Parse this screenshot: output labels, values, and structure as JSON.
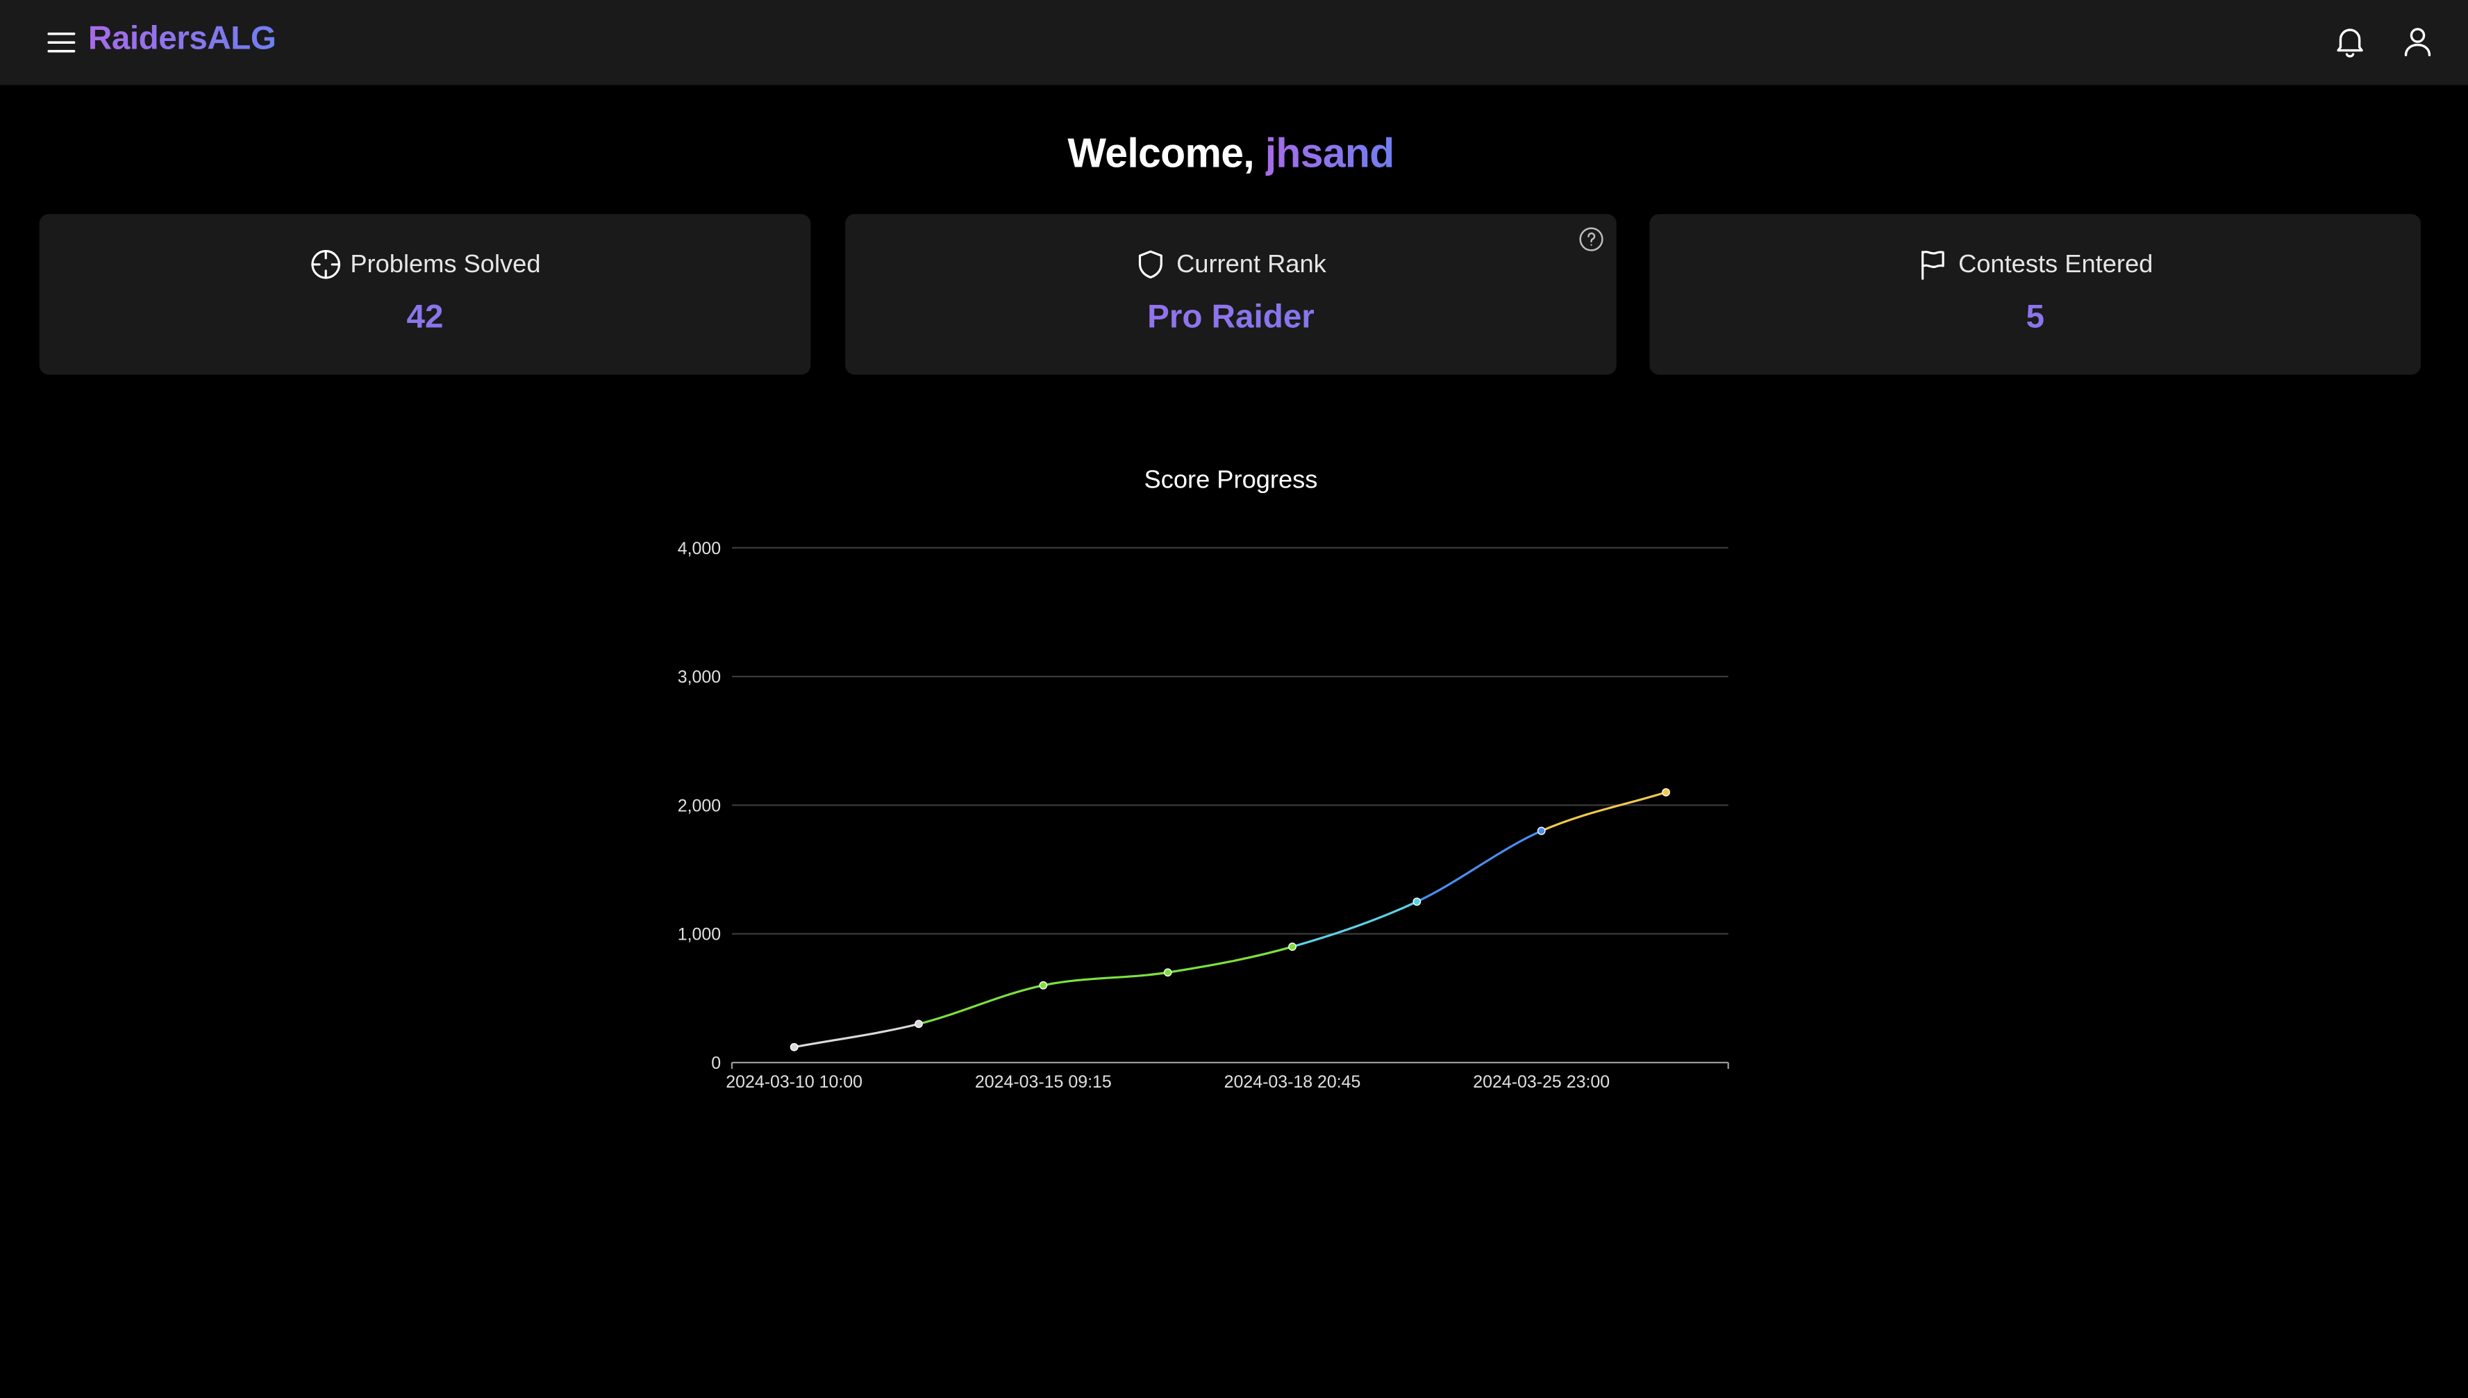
{
  "header": {
    "brand": "RaidersALG",
    "menu_icon": "menu-icon",
    "notification_icon": "bell-icon",
    "profile_icon": "user-icon"
  },
  "welcome": {
    "prefix": "Welcome,",
    "username": "jhsand"
  },
  "stats": [
    {
      "icon": "crosshair-icon",
      "label": "Problems Solved",
      "value": "42"
    },
    {
      "icon": "shield-icon",
      "label": "Current Rank",
      "value": "Pro Raider",
      "help_icon": "question-circle-icon"
    },
    {
      "icon": "flag-icon",
      "label": "Contests Entered",
      "value": "5"
    }
  ],
  "colors": {
    "accent_start": "#a86be8",
    "accent_end": "#6f7ff0",
    "card_bg": "#1a1a1a",
    "page_bg": "#000000"
  },
  "chart_data": {
    "type": "line",
    "title": "Score Progress",
    "x": [
      "2024-03-10 10:00",
      "",
      "2024-03-15 09:15",
      "",
      "2024-03-18 20:45",
      "",
      "2024-03-25 23:00",
      ""
    ],
    "xtick_labels": [
      "2024-03-10 10:00",
      "2024-03-15 09:15",
      "2024-03-18 20:45",
      "2024-03-25 23:00"
    ],
    "values": [
      120,
      300,
      600,
      700,
      900,
      1250,
      1800,
      2100
    ],
    "point_colors": [
      "#d9d9d9",
      "#d9d9d9",
      "#7fe040",
      "#7fe040",
      "#7fe040",
      "#5ed1e6",
      "#4a8ef0",
      "#f2c94c"
    ],
    "ylim": [
      0,
      4000
    ],
    "yticks": [
      "0",
      "1,000",
      "2,000",
      "3,000",
      "4,000"
    ],
    "ytick_values": [
      0,
      1000,
      2000,
      3000,
      4000
    ],
    "grid": true,
    "legend": "none"
  }
}
